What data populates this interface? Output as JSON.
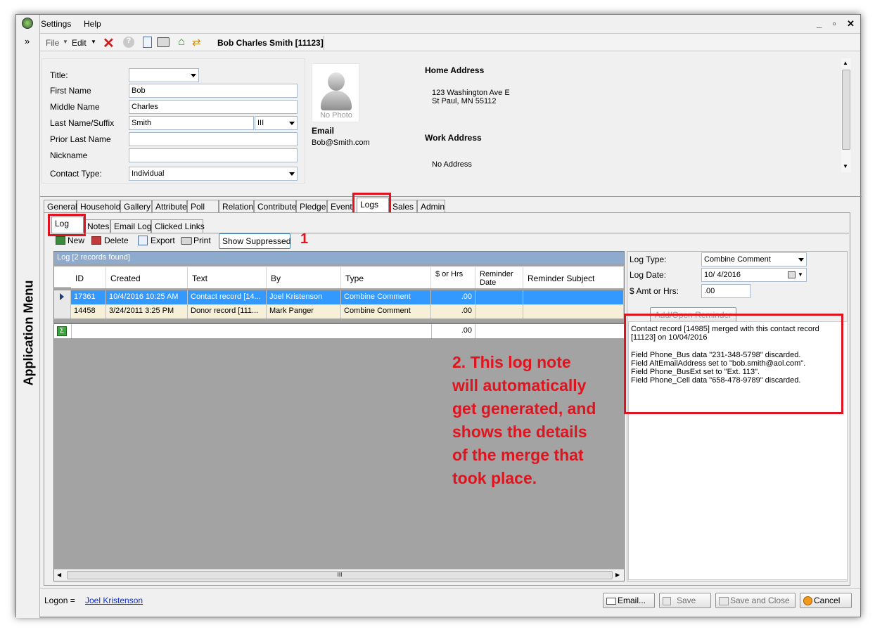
{
  "menubar": {
    "settings": "Settings",
    "help": "Help",
    "window_controls": "_ ▫ ✕"
  },
  "app_menu": {
    "label": "Application Menu",
    "expand": "»"
  },
  "toolbar": {
    "file": "File",
    "edit": "Edit",
    "record_title": "Bob Charles Smith [11123]"
  },
  "form": {
    "title_label": "Title:",
    "title_value": "",
    "first_name_label": "First Name",
    "first_name_value": "Bob",
    "middle_name_label": "Middle Name",
    "middle_name_value": "Charles",
    "last_name_label": "Last Name/Suffix",
    "last_name_value": "Smith",
    "suffix_value": "III",
    "prior_last_label": "Prior Last Name",
    "prior_last_value": "",
    "nickname_label": "Nickname",
    "nickname_value": "",
    "contact_type_label": "Contact Type:",
    "contact_type_value": "Individual"
  },
  "photo": {
    "caption": "No Photo"
  },
  "email": {
    "label": "Email",
    "value": "Bob@Smith.com"
  },
  "home_address": {
    "label": "Home Address",
    "line1": "123 Washington Ave E",
    "line2": "St Paul, MN 55112"
  },
  "work_address": {
    "label": "Work Address",
    "value": "No Address"
  },
  "tabs": [
    "General",
    "Household",
    "Gallery",
    "Attribute",
    "Poll",
    "Relation",
    "Contribute",
    "Pledge",
    "Event",
    "Logs",
    "Sales",
    "Admin"
  ],
  "subtabs": [
    "Log",
    "Notes",
    "Email Log",
    "Clicked Links"
  ],
  "log_toolbar": {
    "new": "New",
    "delete": "Delete",
    "export": "Export",
    "print": "Print",
    "show_suppressed": "Show Suppressed",
    "marker": "1"
  },
  "grid": {
    "caption": "Log [2 records found]",
    "columns": [
      "ID",
      "Created",
      "Text",
      "By",
      "Type",
      "$ or Hrs",
      "Reminder Date",
      "Reminder Subject"
    ],
    "rows": [
      {
        "id": "17361",
        "created": "10/4/2016 10:25 AM",
        "text": "Contact record [14...",
        "by": "Joel Kristenson",
        "type": "Combine Comment",
        "amt": ".00"
      },
      {
        "id": "14458",
        "created": "3/24/2011 3:25 PM",
        "text": "Donor record [111...",
        "by": "Mark Panger",
        "type": "Combine Comment",
        "amt": ".00"
      }
    ],
    "total": ".00",
    "hscroll_grip": "III"
  },
  "detail": {
    "log_type_label": "Log Type:",
    "log_type_value": "Combine Comment",
    "log_date_label": "Log Date:",
    "log_date_value": "10/ 4/2016",
    "amt_label": "$ Amt or Hrs:",
    "amt_value": ".00",
    "reminder_btn": "Add/Open Reminder",
    "note_line1": "Contact record [14985] merged with this contact record",
    "note_line2": "[11123] on 10/04/2016",
    "note_line3": "Field Phone_Bus data \"231-348-5798\" discarded.",
    "note_line4": "Field AltEmailAddress set to \"bob.smith@aol.com\".",
    "note_line5": "Field Phone_BusExt set to \"Ext. 113\".",
    "note_line6": "Field Phone_Cell data \"658-478-9789\" discarded."
  },
  "annotation": {
    "line1": "2. This log note",
    "line2": "will automatically",
    "line3": "get generated, and",
    "line4": "shows the details",
    "line5": "of the merge that",
    "line6": "took place."
  },
  "footer": {
    "logon_label": "Logon =",
    "logon_user": "Joel Kristenson",
    "email": "Email...",
    "save": "Save",
    "save_close": "Save and Close",
    "cancel": "Cancel"
  },
  "colors": {
    "accent": "#3399ff",
    "annotation": "#e0141e",
    "grid_caption": "#8eaacc"
  }
}
